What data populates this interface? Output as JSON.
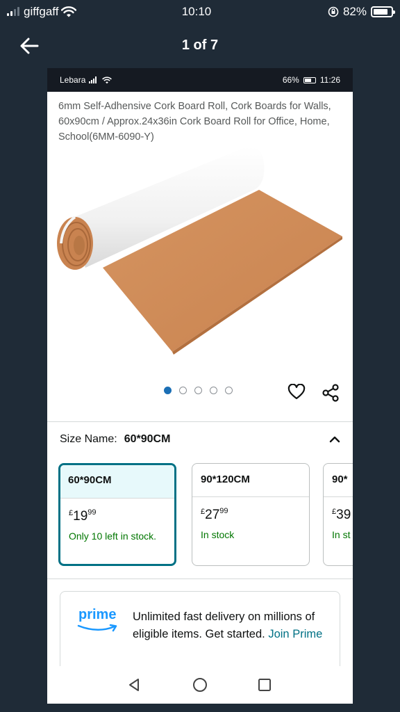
{
  "status": {
    "carrier": "giffgaff",
    "time": "10:10",
    "battery": "82%",
    "battery_level": 0.82
  },
  "viewer": {
    "title": "1 of 7"
  },
  "inner_status": {
    "carrier": "Lebara",
    "battery": "66%",
    "time": "11:26"
  },
  "product": {
    "title": "6mm Self-Adhensive Cork Board Roll, Cork Boards for Walls, 60x90cm / Approx.24x36in Cork Board Roll for Office, Home, School(6MM-6090-Y)",
    "image_count": 5,
    "active_image": 0
  },
  "size": {
    "label": "Size Name:",
    "selected": "60*90CM",
    "options": [
      {
        "name": "60*90CM",
        "currency": "£",
        "price_whole": "19",
        "price_frac": "99",
        "stock": "Only 10 left in stock."
      },
      {
        "name": "90*120CM",
        "currency": "£",
        "price_whole": "27",
        "price_frac": "99",
        "stock": "In stock"
      },
      {
        "name": "90*",
        "currency": "£",
        "price_whole": "39",
        "price_frac": "",
        "stock": "In st"
      }
    ]
  },
  "prime": {
    "logo": "prime",
    "text": "Unlimited fast delivery on millions of eligible items. Get started.",
    "link": "Join Prime"
  },
  "colors": {
    "accent": "#007185",
    "stock_green": "#007600",
    "prime_blue": "#1a98ff",
    "background": "#1f2b37"
  }
}
